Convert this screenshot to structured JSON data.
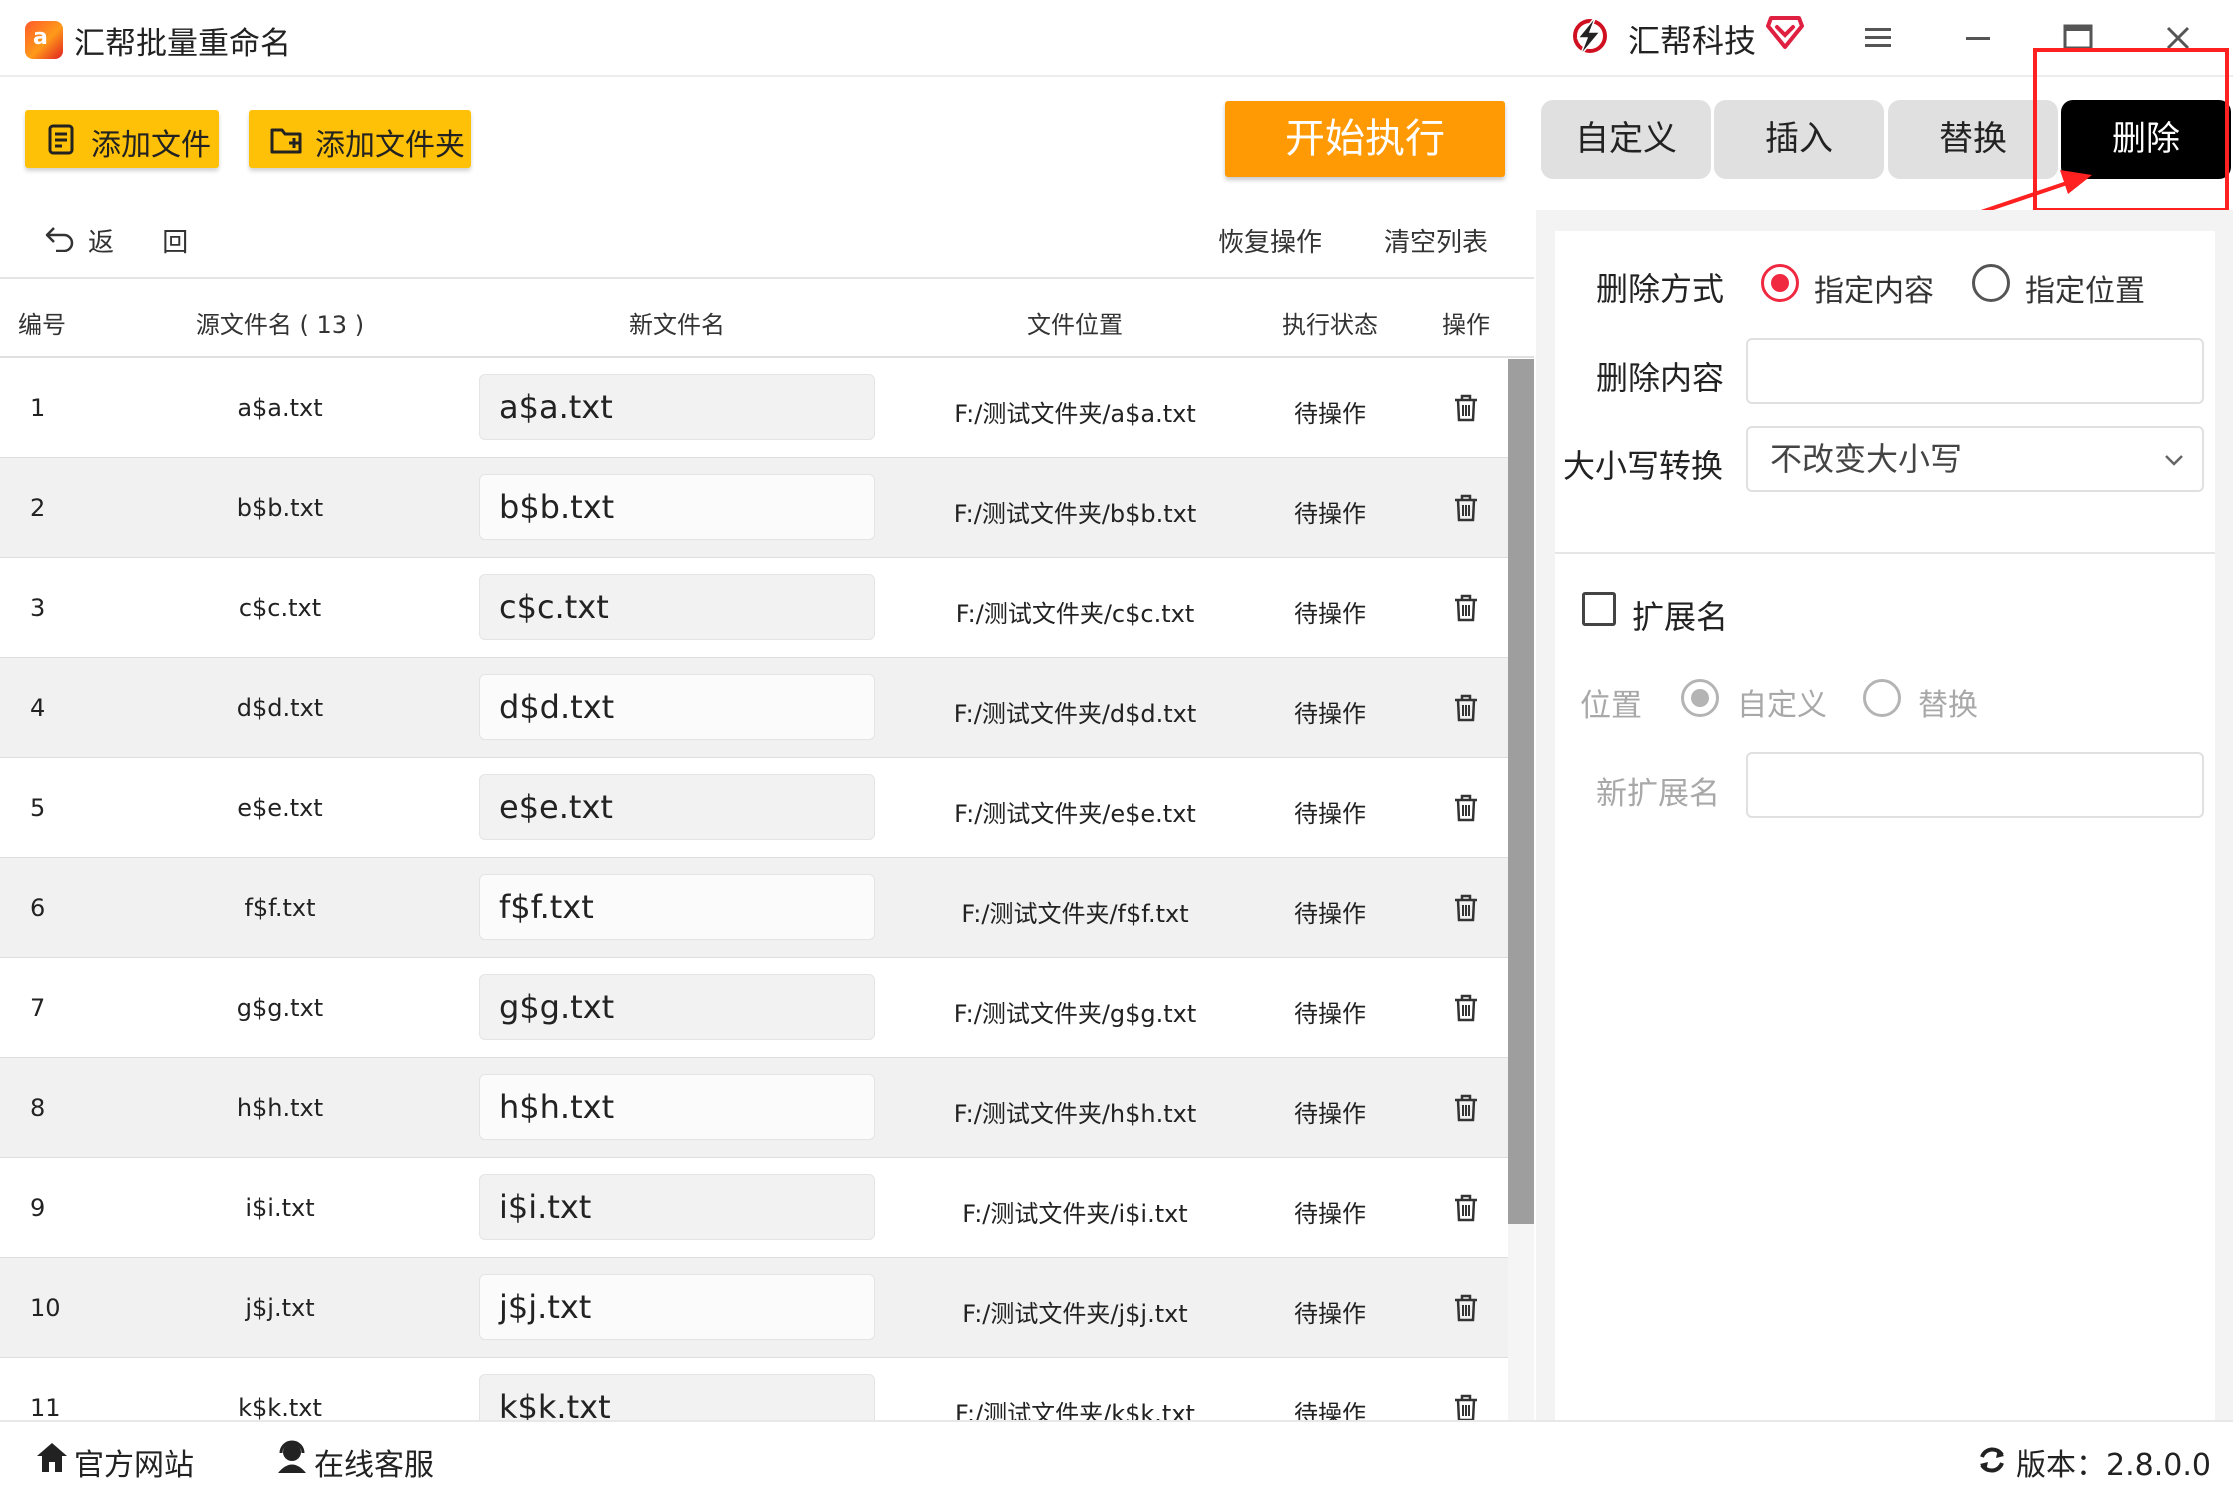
{
  "window": {
    "title": "汇帮批量重命名",
    "brand": "汇帮科技",
    "icon_glyph": "a"
  },
  "toolbar": {
    "add_file": "添加文件",
    "add_folder": "添加文件夹",
    "start": "开始执行",
    "tabs": [
      {
        "label": "自定义",
        "active": false
      },
      {
        "label": "插入",
        "active": false
      },
      {
        "label": "替换",
        "active": false
      },
      {
        "label": "删除",
        "active": true
      }
    ]
  },
  "list_toolbar": {
    "back": "返 回",
    "restore": "恢复操作",
    "clear": "清空列表"
  },
  "table": {
    "headers": {
      "no": "编号",
      "source": "源文件名 ( 13 )",
      "new": "新文件名",
      "location": "文件位置",
      "status": "执行状态",
      "action": "操作"
    },
    "rows": [
      {
        "no": "1",
        "source": "a$a.txt",
        "new": "a$a.txt",
        "location": "F:/测试文件夹/a$a.txt",
        "status": "待操作"
      },
      {
        "no": "2",
        "source": "b$b.txt",
        "new": "b$b.txt",
        "location": "F:/测试文件夹/b$b.txt",
        "status": "待操作"
      },
      {
        "no": "3",
        "source": "c$c.txt",
        "new": "c$c.txt",
        "location": "F:/测试文件夹/c$c.txt",
        "status": "待操作"
      },
      {
        "no": "4",
        "source": "d$d.txt",
        "new": "d$d.txt",
        "location": "F:/测试文件夹/d$d.txt",
        "status": "待操作"
      },
      {
        "no": "5",
        "source": "e$e.txt",
        "new": "e$e.txt",
        "location": "F:/测试文件夹/e$e.txt",
        "status": "待操作"
      },
      {
        "no": "6",
        "source": "f$f.txt",
        "new": "f$f.txt",
        "location": "F:/测试文件夹/f$f.txt",
        "status": "待操作"
      },
      {
        "no": "7",
        "source": "g$g.txt",
        "new": "g$g.txt",
        "location": "F:/测试文件夹/g$g.txt",
        "status": "待操作"
      },
      {
        "no": "8",
        "source": "h$h.txt",
        "new": "h$h.txt",
        "location": "F:/测试文件夹/h$h.txt",
        "status": "待操作"
      },
      {
        "no": "9",
        "source": "i$i.txt",
        "new": "i$i.txt",
        "location": "F:/测试文件夹/i$i.txt",
        "status": "待操作"
      },
      {
        "no": "10",
        "source": "j$j.txt",
        "new": "j$j.txt",
        "location": "F:/测试文件夹/j$j.txt",
        "status": "待操作"
      },
      {
        "no": "11",
        "source": "k$k.txt",
        "new": "k$k.txt",
        "location": "F:/测试文件夹/k$k.txt",
        "status": "待操作"
      }
    ]
  },
  "panel": {
    "mode_label": "删除方式",
    "mode_options": [
      "指定内容",
      "指定位置"
    ],
    "mode_selected": "指定内容",
    "content_label": "删除内容",
    "content_value": "",
    "case_label": "大小写转换",
    "case_value": "不改变大小写",
    "ext_label": "扩展名",
    "ext_checked": false,
    "position_label": "位置",
    "position_options": [
      "自定义",
      "替换"
    ],
    "position_selected": "自定义",
    "new_ext_label": "新扩展名",
    "new_ext_value": ""
  },
  "statusbar": {
    "website": "官方网站",
    "support": "在线客服",
    "version": "版本：2.8.0.0"
  },
  "colors": {
    "accent_yellow": "#ffc107",
    "start_orange": "#ff9a05",
    "radio_red": "#f02840",
    "annotation_red": "#ff2020"
  }
}
